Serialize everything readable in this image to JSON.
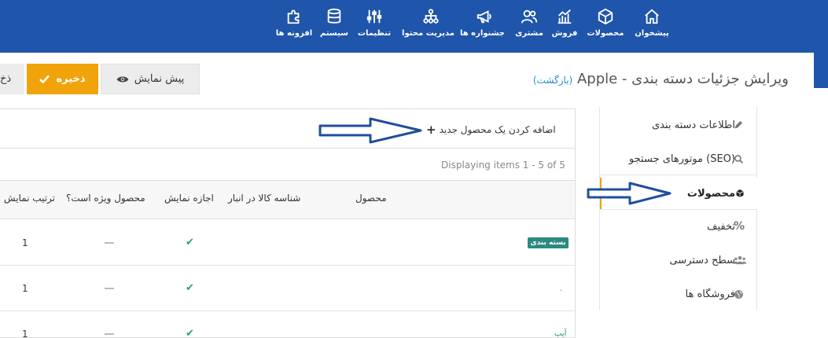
{
  "nav": {
    "items": [
      {
        "label": "پیشخوان",
        "icon": "home-icon"
      },
      {
        "label": "محصولات",
        "icon": "cube-icon"
      },
      {
        "label": "فروش",
        "icon": "chart-icon"
      },
      {
        "label": "مشتری",
        "icon": "users-icon"
      },
      {
        "label": "جشنواره ها",
        "icon": "megaphone-icon"
      },
      {
        "label": "مدیریت محتوا",
        "icon": "sitemap-icon"
      },
      {
        "label": "تنظیمات",
        "icon": "sliders-icon"
      },
      {
        "label": "سیستم",
        "icon": "database-icon"
      },
      {
        "label": "افزونه ها",
        "icon": "puzzle-icon"
      }
    ]
  },
  "header": {
    "title": "ویرایش جزئیات دسته بندی - Apple",
    "back_link": "(بازگشت)"
  },
  "toolbar": {
    "preview_label": "پیش نمایش",
    "save_label": "ذخیره",
    "save_continue_label": "ذخ"
  },
  "sidebar": {
    "items": [
      {
        "label": "اطلاعات دسته بندی",
        "icon": "pencil-icon"
      },
      {
        "label": "(SEO) موتورهای جستجو",
        "icon": "search-icon"
      },
      {
        "label": "محصولات",
        "icon": "box-icon"
      },
      {
        "label": "تخفیف",
        "icon": "percent-icon"
      },
      {
        "label": "سطح دسترسی",
        "icon": "users-icon"
      },
      {
        "label": "فروشگاه ها",
        "icon": "globe-icon"
      }
    ]
  },
  "products": {
    "add_label": "اضافه کردن یک محصول جدید",
    "display_info": "Displaying items 1 - 5 of 5",
    "columns": [
      "محصول",
      "شناسه کالا در انبار",
      "اجازه نمایش",
      "محصول ویژه است؟",
      "ترتیب نمایش"
    ],
    "rows": [
      {
        "product": "بسته بندی",
        "order": "1"
      },
      {
        "product": ".",
        "order": "1"
      },
      {
        "product": "آیپ",
        "order": "1"
      }
    ]
  },
  "colors": {
    "topbar": "#1f55ab",
    "accent": "#f0a30a",
    "check": "#2e9e6a",
    "arrow": "#1f4f9c"
  }
}
